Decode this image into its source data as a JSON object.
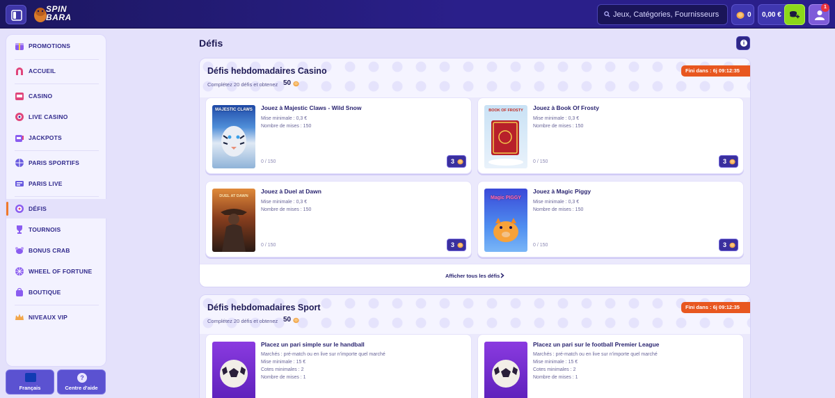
{
  "header": {
    "logo_text_top": "SPIN",
    "logo_text_bottom": "BARA",
    "search_placeholder": "Jeux, Catégories, Fournisseurs",
    "coins_count": "0",
    "balance": "0,00 €",
    "notifications_count": "1"
  },
  "sidebar": {
    "items": [
      {
        "label": "PROMOTIONS",
        "icon": "gift-icon"
      },
      {
        "label": "ACCUEIL",
        "icon": "horseshoe-icon"
      },
      {
        "label": "CASINO",
        "icon": "slot-icon"
      },
      {
        "label": "LIVE CASINO",
        "icon": "chip-icon"
      },
      {
        "label": "JACKPOTS",
        "icon": "jackpot-icon"
      },
      {
        "label": "PARIS SPORTIFS",
        "icon": "ball-icon"
      },
      {
        "label": "PARIS LIVE",
        "icon": "ticket-icon"
      },
      {
        "label": "DÉFIS",
        "icon": "target-icon"
      },
      {
        "label": "TOURNOIS",
        "icon": "trophy-icon"
      },
      {
        "label": "BONUS CRAB",
        "icon": "crab-icon"
      },
      {
        "label": "WHEEL OF FORTUNE",
        "icon": "wheel-icon"
      },
      {
        "label": "BOUTIQUE",
        "icon": "bag-icon"
      },
      {
        "label": "NIVEAUX VIP",
        "icon": "crown-icon"
      }
    ],
    "language_label": "Français",
    "help_label": "Centre d'aide",
    "help_glyph": "?"
  },
  "main": {
    "page_title": "Défis",
    "info_glyph": "i",
    "casino": {
      "title": "Défis hebdomadaires Casino",
      "subtitle": "Complétez 20 défis et obtenez",
      "reward": "50",
      "timer": "Fini dans : 6j 09:12:35",
      "show_all": "Afficher tous les défis",
      "cards": [
        {
          "title": "Jouez à Majestic Claws - Wild Snow",
          "min_bet": "Mise minimale : 0,3 €",
          "bets": "Nombre de mises : 150",
          "progress": "0 / 150",
          "reward": "3",
          "thumb_text": "MAJESTIC CLAWS"
        },
        {
          "title": "Jouez à Book Of Frosty",
          "min_bet": "Mise minimale : 0,3 €",
          "bets": "Nombre de mises : 150",
          "progress": "0 / 150",
          "reward": "3",
          "thumb_text": "BOOK OF FROSTY"
        },
        {
          "title": "Jouez à Duel at Dawn",
          "min_bet": "Mise minimale : 0,3 €",
          "bets": "Nombre de mises : 150",
          "progress": "0 / 150",
          "reward": "3",
          "thumb_text": "DUEL AT DAWN"
        },
        {
          "title": "Jouez à Magic Piggy",
          "min_bet": "Mise minimale : 0,3 €",
          "bets": "Nombre de mises : 150",
          "progress": "0 / 150",
          "reward": "3",
          "thumb_text": "Magic PIGGY"
        }
      ]
    },
    "sport": {
      "title": "Défis hebdomadaires Sport",
      "subtitle": "Complétez 20 défis et obtenez",
      "reward": "50",
      "timer": "Fini dans : 6j 09:12:35",
      "cards": [
        {
          "title": "Placez un pari simple sur le handball",
          "markets": "Marchés :  pré-match ou en live sur n'importe quel marché",
          "min_bet": "Mise minimale : 15 €",
          "min_odds": "Cotes minimales : 2",
          "bets": "Nombre de mises : 1"
        },
        {
          "title": "Placez un pari sur le football Premier League",
          "markets": "Marchés :  pré-match ou en live sur n'importe quel marché",
          "min_bet": "Mise minimale : 15 €",
          "min_odds": "Cotes minimales : 2",
          "bets": "Nombre de mises : 1"
        }
      ]
    }
  },
  "colors": {
    "header": "#2a1f8a",
    "accent_orange": "#e8571f",
    "deposit_green": "#8cd81a",
    "reward_badge": "#3a2f9e"
  }
}
